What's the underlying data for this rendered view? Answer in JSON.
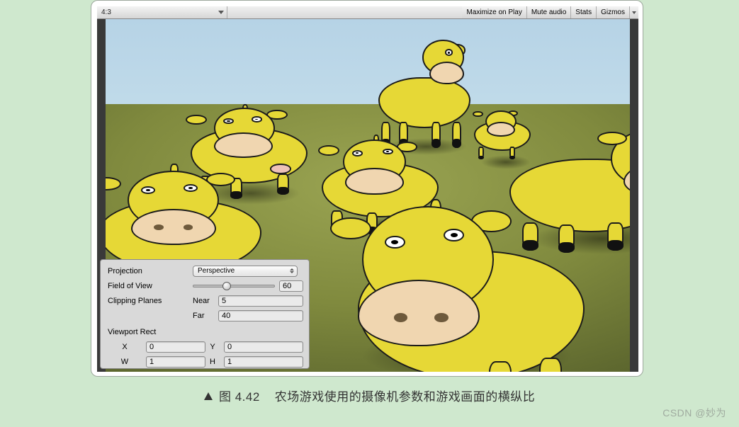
{
  "toolbar": {
    "aspect_ratio": "4:3",
    "maximize_label": "Maximize on Play",
    "mute_label": "Mute audio",
    "stats_label": "Stats",
    "gizmos_label": "Gizmos"
  },
  "camera_panel": {
    "projection_label": "Projection",
    "projection_value": "Perspective",
    "fov_label": "Field of View",
    "fov_value": "60",
    "clipping_label": "Clipping Planes",
    "near_label": "Near",
    "near_value": "5",
    "far_label": "Far",
    "far_value": "40",
    "viewport_label": "Viewport Rect",
    "x_label": "X",
    "x_value": "0",
    "y_label": "Y",
    "y_value": "0",
    "w_label": "W",
    "w_value": "1",
    "h_label": "H",
    "h_value": "1"
  },
  "caption": {
    "fig_label": "图 4.42",
    "text": "农场游戏使用的摄像机参数和游戏画面的横纵比"
  },
  "watermark": "CSDN @妙为"
}
